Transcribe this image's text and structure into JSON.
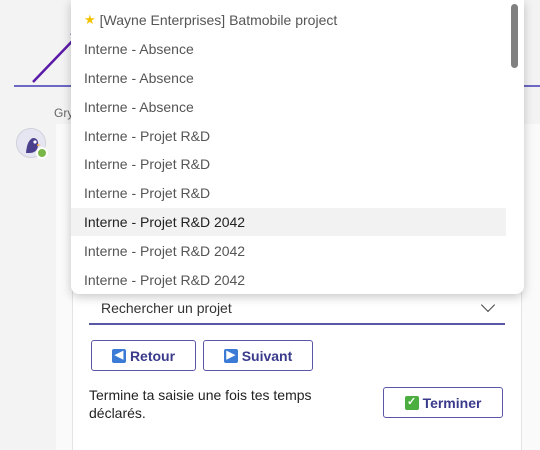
{
  "chat": {
    "sender_name": "Gry"
  },
  "form": {
    "project_select_placeholder": "Rechercher un projet",
    "prev_label": "Retour",
    "next_label": "Suivant",
    "finish_text": "Termine ta saisie une fois tes temps déclarés.",
    "finish_label": "Terminer"
  },
  "dropdown": {
    "options": [
      {
        "label": "[Wayne Enterprises] Batmobile project",
        "starred": true
      },
      {
        "label": "Interne - Absence"
      },
      {
        "label": "Interne - Absence"
      },
      {
        "label": "Interne - Absence"
      },
      {
        "label": "Interne - Projet R&D"
      },
      {
        "label": "Interne - Projet R&D"
      },
      {
        "label": "Interne - Projet R&D"
      },
      {
        "label": "Interne - Projet R&D 2042",
        "hovered": true
      },
      {
        "label": "Interne - Projet R&D 2042"
      },
      {
        "label": "Interne - Projet R&D 2042"
      }
    ]
  },
  "icons": {
    "star": "star-icon",
    "prev": "left-arrow-icon",
    "next": "right-arrow-icon",
    "finish": "check-mark-icon",
    "chevron": "chevron-down-icon"
  },
  "colors": {
    "accent": "#5b57a8",
    "annotation_arrow": "#5a1aa8",
    "status_online": "#7ab648"
  }
}
